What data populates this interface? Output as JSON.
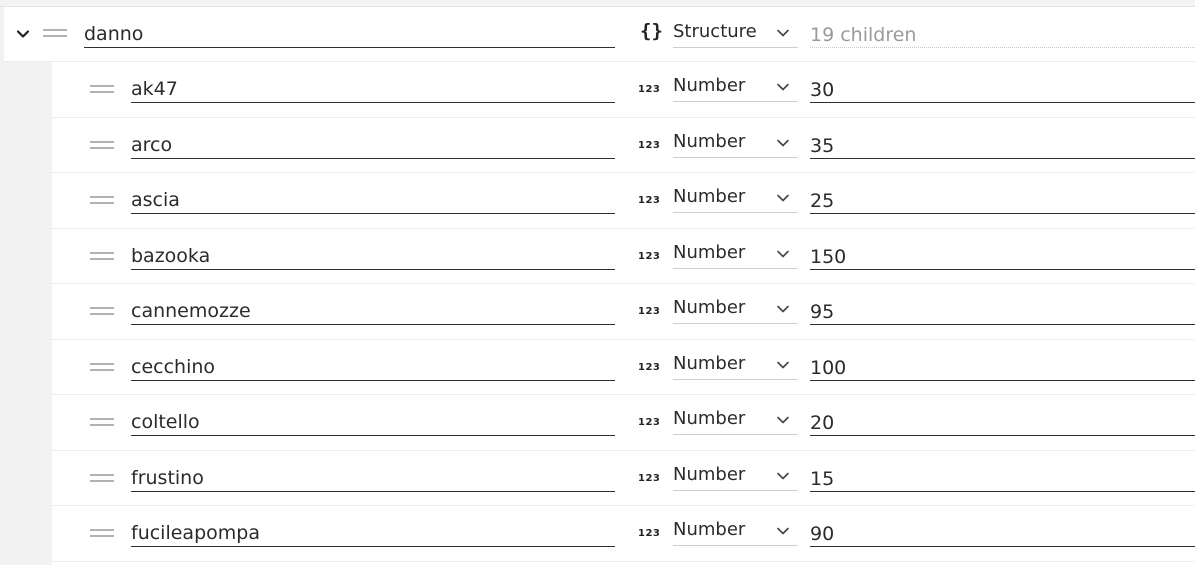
{
  "parent": {
    "name": "danno",
    "type_icon": "braces-icon",
    "type_glyph": "{}",
    "type_label": "Structure",
    "value": "19 children"
  },
  "number_glyph": "123",
  "children": [
    {
      "name": "ak47",
      "type_label": "Number",
      "value": "30"
    },
    {
      "name": "arco",
      "type_label": "Number",
      "value": "35"
    },
    {
      "name": "ascia",
      "type_label": "Number",
      "value": "25"
    },
    {
      "name": "bazooka",
      "type_label": "Number",
      "value": "150"
    },
    {
      "name": "cannemozze",
      "type_label": "Number",
      "value": "95"
    },
    {
      "name": "cecchino",
      "type_label": "Number",
      "value": "100"
    },
    {
      "name": "coltello",
      "type_label": "Number",
      "value": "20"
    },
    {
      "name": "frustino",
      "type_label": "Number",
      "value": "15"
    },
    {
      "name": "fucileapompa",
      "type_label": "Number",
      "value": "90"
    }
  ],
  "colors": {
    "background": "#f2f2f2",
    "row_background": "#ffffff",
    "text": "#2b2b2b",
    "muted_text": "#9a9a9a",
    "handle": "#b2b2b2"
  }
}
